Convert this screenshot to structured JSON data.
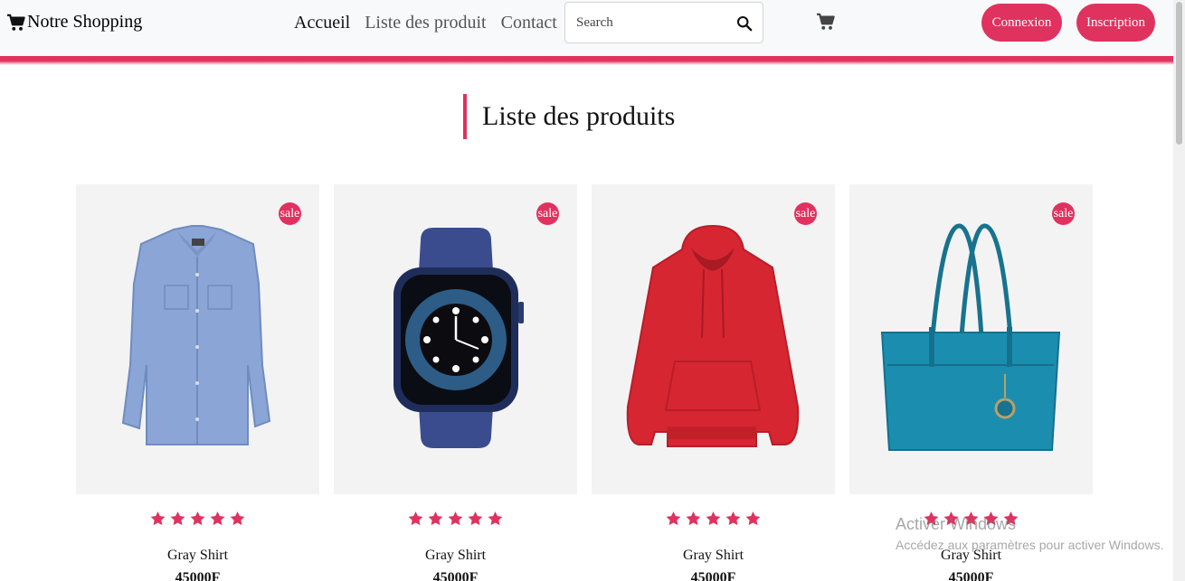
{
  "navbar": {
    "brand": "Notre Shopping",
    "links": [
      "Accueil",
      "Liste des produit",
      "Contact"
    ],
    "search_placeholder": "Search",
    "login_label": "Connexion",
    "register_label": "Inscription"
  },
  "colors": {
    "accent": "#e0325f",
    "navbar_bg": "#f8f9fa",
    "card_bg": "#f3f3f3"
  },
  "section": {
    "title": "Liste des produits"
  },
  "products": [
    {
      "badge": "sale",
      "name": "Gray Shirt",
      "price": "45000F",
      "rating": 5,
      "image": "blue-shirt"
    },
    {
      "badge": "sale",
      "name": "Gray Shirt",
      "price": "45000F",
      "rating": 5,
      "image": "smart-watch"
    },
    {
      "badge": "sale",
      "name": "Gray Shirt",
      "price": "45000F",
      "rating": 5,
      "image": "red-hoodie"
    },
    {
      "badge": "sale",
      "name": "Gray Shirt",
      "price": "45000F",
      "rating": 5,
      "image": "teal-handbag"
    }
  ],
  "watermark": {
    "title": "Activer Windows",
    "subtitle": "Accédez aux paramètres pour activer Windows."
  }
}
